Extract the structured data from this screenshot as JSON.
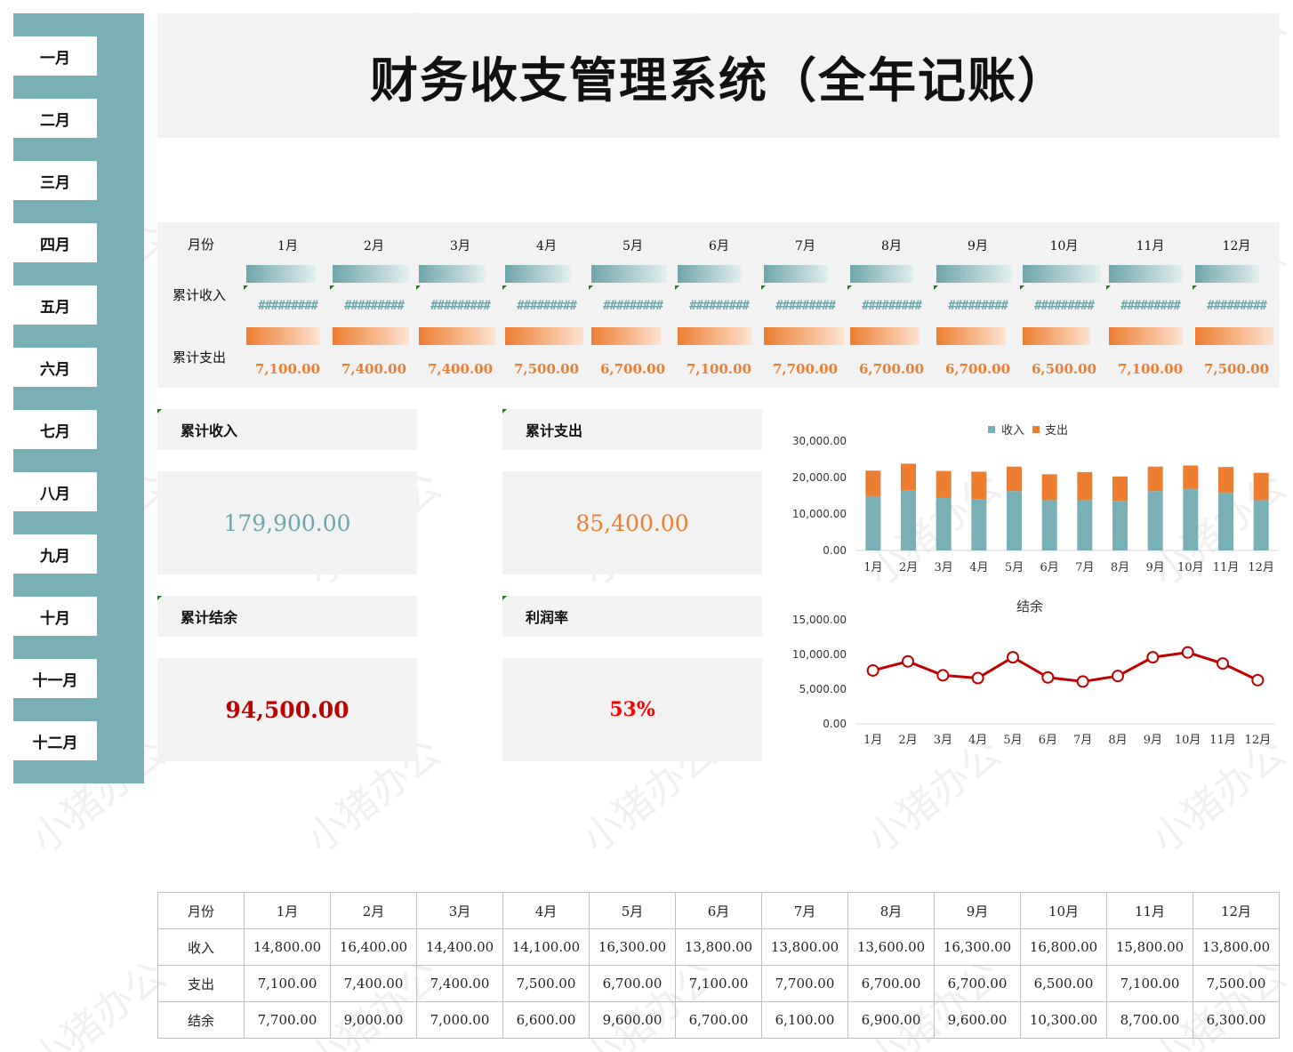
{
  "title": "财务收支管理系统（全年记账）",
  "sidebar": {
    "items": [
      "一月",
      "二月",
      "三月",
      "四月",
      "五月",
      "六月",
      "七月",
      "八月",
      "九月",
      "十月",
      "十一月",
      "十二月"
    ]
  },
  "strip": {
    "month_label": "月份",
    "income_label": "累计收入",
    "expense_label": "累计支出",
    "hash_text": "#########"
  },
  "kpis": {
    "income": {
      "label": "累计收入",
      "value": "179,900.00",
      "color": "#6ea6ab"
    },
    "expense": {
      "label": "累计支出",
      "value": "85,400.00",
      "color": "#ed7d31"
    },
    "balance": {
      "label": "累计结余",
      "value": "94,500.00",
      "color": "#c00000"
    },
    "margin": {
      "label": "利润率",
      "value": "53%",
      "color": "#ff0000"
    }
  },
  "colors": {
    "income": "#79b0b5",
    "expense": "#ed7d31",
    "balance_line": "#c00000",
    "panel": "#f2f2f2"
  },
  "table": {
    "header_label": "月份",
    "row_labels": [
      "收入",
      "支出",
      "结余"
    ],
    "income_display": [
      "14,800.00",
      "16,400.00",
      "14,400.00",
      "14,100.00",
      "16,300.00",
      "13,800.00",
      "13,800.00",
      "13,600.00",
      "16,300.00",
      "16,800.00",
      "15,800.00",
      "13,800.00"
    ],
    "expense_display": [
      "7,100.00",
      "7,400.00",
      "7,400.00",
      "7,500.00",
      "6,700.00",
      "7,100.00",
      "7,700.00",
      "6,700.00",
      "6,700.00",
      "6,500.00",
      "7,100.00",
      "7,500.00"
    ],
    "balance_display": [
      "7,700.00",
      "9,000.00",
      "7,000.00",
      "6,600.00",
      "9,600.00",
      "6,700.00",
      "6,100.00",
      "6,900.00",
      "9,600.00",
      "10,300.00",
      "8,700.00",
      "6,300.00"
    ]
  },
  "chart_data": [
    {
      "type": "bar",
      "stacked": true,
      "categories": [
        "1月",
        "2月",
        "3月",
        "4月",
        "5月",
        "6月",
        "7月",
        "8月",
        "9月",
        "10月",
        "11月",
        "12月"
      ],
      "series": [
        {
          "name": "收入",
          "values": [
            14800,
            16400,
            14400,
            14100,
            16300,
            13800,
            13800,
            13600,
            16300,
            16800,
            15800,
            13800
          ]
        },
        {
          "name": "支出",
          "values": [
            7100,
            7400,
            7400,
            7500,
            6700,
            7100,
            7700,
            6700,
            6700,
            6500,
            7100,
            7500
          ]
        }
      ],
      "ylim": [
        0,
        30000
      ],
      "yticks": [
        "30,000.00",
        "20,000.00",
        "10,000.00",
        "0.00"
      ],
      "legend": "top-center",
      "title": ""
    },
    {
      "type": "line",
      "categories": [
        "1月",
        "2月",
        "3月",
        "4月",
        "5月",
        "6月",
        "7月",
        "8月",
        "9月",
        "10月",
        "11月",
        "12月"
      ],
      "series": [
        {
          "name": "结余",
          "values": [
            7700,
            9000,
            7000,
            6600,
            9600,
            6700,
            6100,
            6900,
            9600,
            10300,
            8700,
            6300
          ]
        }
      ],
      "ylim": [
        0,
        15000
      ],
      "yticks": [
        "15,000.00",
        "10,000.00",
        "5,000.00",
        "0.00"
      ],
      "title": "结余"
    }
  ],
  "watermark": "小猪办公"
}
